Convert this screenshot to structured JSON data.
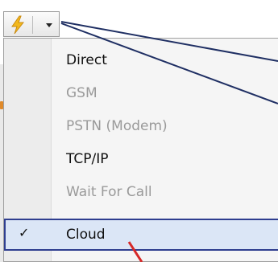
{
  "toolbar": {
    "connection_button_icon": "lightning-bolt-icon",
    "dropdown_icon": "chevron-down-icon"
  },
  "menu": {
    "items": [
      {
        "label": "Direct",
        "enabled": true,
        "checked": false
      },
      {
        "label": "GSM",
        "enabled": false,
        "checked": false
      },
      {
        "label": "PSTN (Modem)",
        "enabled": false,
        "checked": false
      },
      {
        "label": "TCP/IP",
        "enabled": true,
        "checked": false
      },
      {
        "label": "Wait For Call",
        "enabled": false,
        "checked": false
      },
      {
        "label": "Cloud",
        "enabled": true,
        "checked": true
      }
    ],
    "check_glyph": "✓"
  },
  "colors": {
    "callout_line": "#1f2f63",
    "annotation_arrow": "#d62828",
    "selection_border": "#2f3e8f",
    "selection_fill": "#dbe6f6",
    "bolt_fill": "#f2b81c"
  }
}
